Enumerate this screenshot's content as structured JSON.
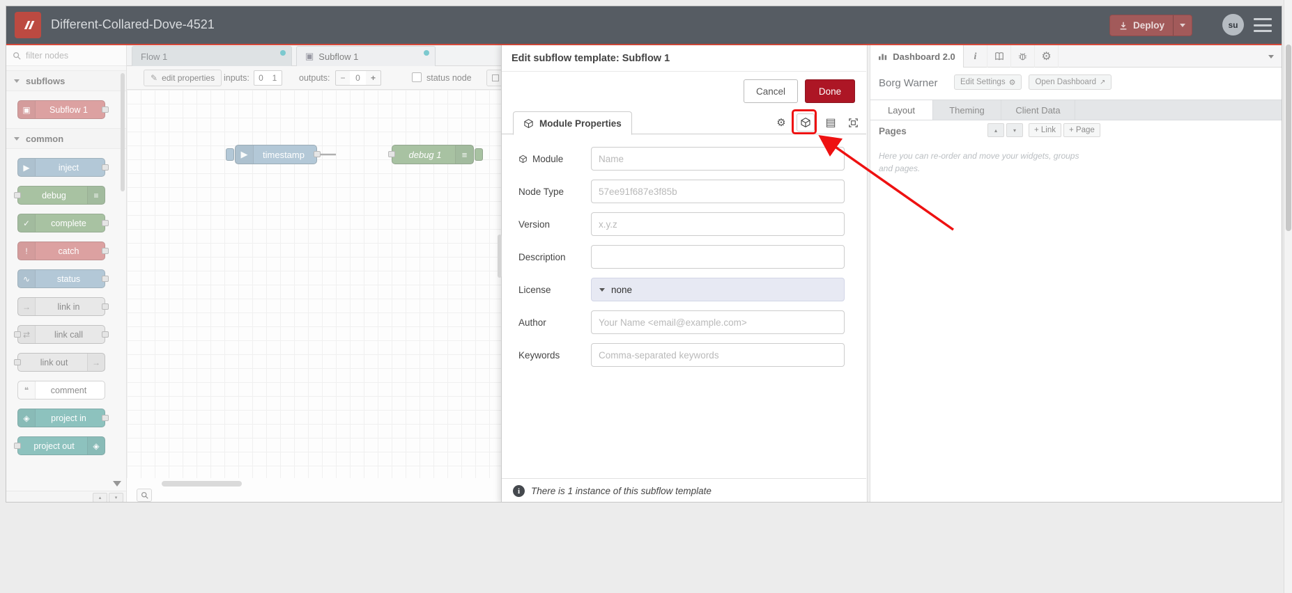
{
  "window": {
    "title": "Different-Collared-Dove-4521",
    "deploy": "Deploy",
    "avatar": "su"
  },
  "colors": {
    "brand_red": "#bc4a41",
    "deploy_red": "#a25a5a",
    "done_red": "#ad1625",
    "annotation_red": "#ee1111",
    "tab_dot_teal": "#3eb0b8"
  },
  "palette": {
    "filter_placeholder": "filter nodes",
    "categories": [
      {
        "label": "subflows",
        "nodes": [
          {
            "label": "Subflow 1",
            "color": "#cc7575",
            "glyph": "▣"
          }
        ]
      },
      {
        "label": "common",
        "nodes": [
          {
            "label": "inject",
            "color": "#8fafc4",
            "glyph": "▶"
          },
          {
            "label": "debug",
            "color": "#7fa577",
            "glyph": "≡"
          },
          {
            "label": "complete",
            "color": "#7fa577",
            "glyph": "✓"
          },
          {
            "label": "catch",
            "color": "#cc7575",
            "glyph": "!"
          },
          {
            "label": "status",
            "color": "#8fafc4",
            "glyph": "∿"
          },
          {
            "label": "link in",
            "color": "#dddddd",
            "glyph": "→"
          },
          {
            "label": "link call",
            "color": "#dddddd",
            "glyph": "⇄"
          },
          {
            "label": "link out",
            "color": "#dddddd",
            "glyph": "→"
          },
          {
            "label": "comment",
            "color": "#ffffff",
            "glyph": "❝"
          },
          {
            "label": "project in",
            "color": "#58a5a0",
            "glyph": "◈"
          },
          {
            "label": "project out",
            "color": "#58a5a0",
            "glyph": "◈"
          }
        ]
      }
    ]
  },
  "tabs": {
    "flow1": "Flow 1",
    "subflow1": "Subflow 1",
    "subflow_glyph": "▣"
  },
  "toolbar": {
    "edit_properties": "edit properties",
    "inputs_label": "inputs:",
    "input_zero": "0",
    "input_one": "1",
    "outputs_label": "outputs:",
    "outputs_minus": "−",
    "outputs_value": "0",
    "outputs_plus": "+",
    "status_node": "status node"
  },
  "canvas": {
    "inject_node": "timestamp",
    "debug_node": "debug 1"
  },
  "dialog": {
    "title": "Edit subflow template: Subflow 1",
    "cancel": "Cancel",
    "done": "Done",
    "tab_label": "Module Properties",
    "fields": {
      "module": {
        "label": "Module",
        "placeholder": "Name"
      },
      "node_type": {
        "label": "Node Type",
        "placeholder": "57ee91f687e3f85b"
      },
      "version": {
        "label": "Version",
        "placeholder": "x.y.z"
      },
      "description": {
        "label": "Description",
        "placeholder": ""
      },
      "license": {
        "label": "License",
        "value": "none"
      },
      "author": {
        "label": "Author",
        "placeholder": "Your Name <email@example.com>"
      },
      "keywords": {
        "label": "Keywords",
        "placeholder": "Comma-separated keywords"
      }
    },
    "footer_note": "There is 1 instance of this subflow template"
  },
  "sidebar": {
    "active_tab": "Dashboard 2.0",
    "project_name": "Borg Warner",
    "edit_settings": "Edit Settings",
    "open_dashboard": "Open Dashboard",
    "tabs": {
      "layout": "Layout",
      "theming": "Theming",
      "client_data": "Client Data"
    },
    "pages_label": "Pages",
    "add_link": "+ Link",
    "add_page": "+ Page",
    "help_text": "Here you can re-order and move your widgets, groups and pages."
  }
}
